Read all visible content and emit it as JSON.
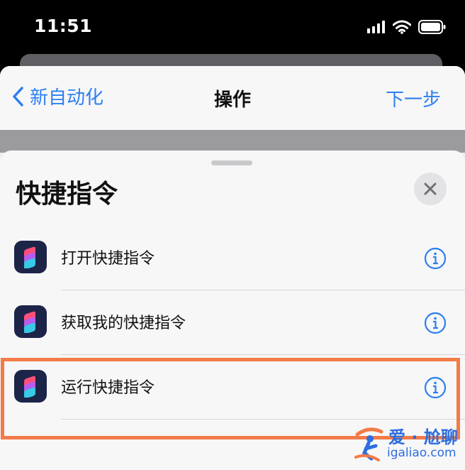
{
  "status": {
    "time": "11:51"
  },
  "nav": {
    "back_label": "新自动化",
    "title": "操作",
    "next_label": "下一步"
  },
  "panel": {
    "title": "快捷指令",
    "items": [
      {
        "label": "打开快捷指令"
      },
      {
        "label": "获取我的快捷指令"
      },
      {
        "label": "运行快捷指令"
      }
    ]
  },
  "watermark": {
    "top": "爱 · 尬聊",
    "bottom": "igaliao.com"
  },
  "colors": {
    "accent": "#2c7ff0",
    "highlight": "#f37b47",
    "icon_bg": "#1c2448"
  },
  "icons": [
    "signal-icon",
    "wifi-icon",
    "battery-icon",
    "chevron-left-icon",
    "close-icon",
    "shortcuts-app-icon",
    "info-icon"
  ]
}
